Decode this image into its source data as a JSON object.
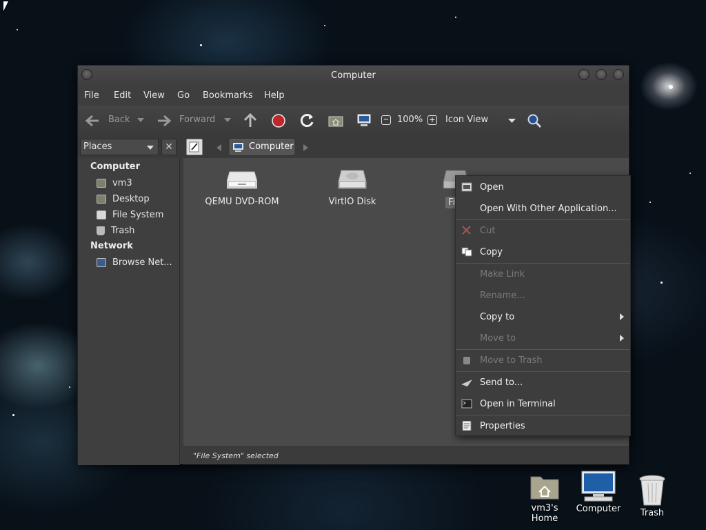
{
  "window": {
    "title": "Computer",
    "menu": [
      "File",
      "Edit",
      "View",
      "Go",
      "Bookmarks",
      "Help"
    ]
  },
  "toolbar": {
    "back_label": "Back",
    "forward_label": "Forward",
    "zoom": "100%",
    "view_mode": "Icon View"
  },
  "pathbar": {
    "crumb": "Computer"
  },
  "sidebar": {
    "selector": "Places",
    "close": "✕",
    "sections": [
      {
        "title": "Computer",
        "items": [
          "vm3",
          "Desktop",
          "File System",
          "Trash"
        ]
      },
      {
        "title": "Network",
        "items": [
          "Browse Net..."
        ]
      }
    ]
  },
  "files": [
    {
      "name": "QEMU DVD-ROM",
      "icon": "optical-drive-icon"
    },
    {
      "name": "VirtIO Disk",
      "icon": "hard-disk-icon"
    },
    {
      "name": "File",
      "icon": "file-system-icon",
      "selected": true
    }
  ],
  "context_menu": {
    "items": [
      {
        "label": "Open",
        "enabled": true,
        "icon": "open-icon"
      },
      {
        "label": "Open With Other Application...",
        "enabled": true
      },
      {
        "label": "Cut",
        "enabled": false,
        "icon": "scissors-icon"
      },
      {
        "label": "Copy",
        "enabled": true,
        "icon": "copy-icon"
      },
      {
        "label": "Make Link",
        "enabled": false
      },
      {
        "label": "Rename...",
        "enabled": false
      },
      {
        "label": "Copy to",
        "enabled": true,
        "submenu": true
      },
      {
        "label": "Move to",
        "enabled": false,
        "submenu": true
      },
      {
        "label": "Move to Trash",
        "enabled": false,
        "icon": "trash-icon"
      },
      {
        "label": "Send to...",
        "enabled": true,
        "icon": "send-icon"
      },
      {
        "label": "Open in Terminal",
        "enabled": true,
        "icon": "terminal-icon"
      },
      {
        "label": "Properties",
        "enabled": true,
        "icon": "properties-icon"
      }
    ]
  },
  "status": "\"File System\" selected",
  "desktop": [
    {
      "label": "vm3's Home",
      "icon": "home-folder-icon"
    },
    {
      "label": "Computer",
      "icon": "computer-icon"
    },
    {
      "label": "Trash",
      "icon": "trash-can-icon"
    }
  ],
  "colors": {
    "window_bg": "#3c3c3c",
    "menu_bg": "#3d3d3d",
    "disabled_text": "#7a7a7a",
    "stop_red": "#c0272d"
  }
}
